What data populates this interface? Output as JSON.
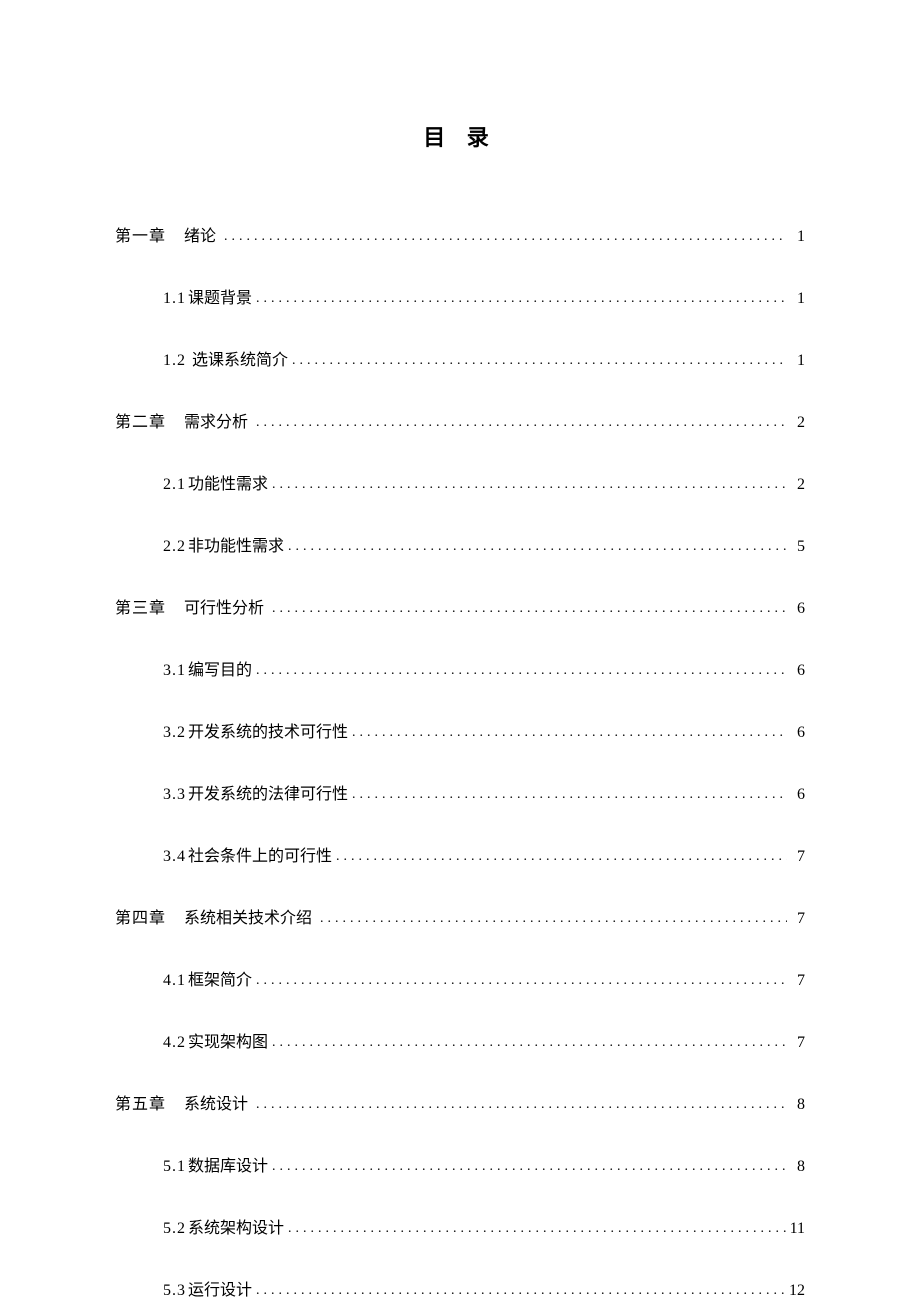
{
  "title": "目 录",
  "toc": [
    {
      "level": "chapter",
      "num": "第一章",
      "text": "绪论",
      "page": "1"
    },
    {
      "level": "section",
      "num": "1.1",
      "text": "课题背景",
      "page": "1"
    },
    {
      "level": "section",
      "num": "1.2",
      "text": "选课系统简介",
      "page": "1",
      "numSpaced": true
    },
    {
      "level": "chapter",
      "num": "第二章",
      "text": "需求分析",
      "page": "2"
    },
    {
      "level": "section",
      "num": "2.1",
      "text": "功能性需求",
      "page": "2"
    },
    {
      "level": "section",
      "num": "2.2",
      "text": "非功能性需求",
      "page": "5"
    },
    {
      "level": "chapter",
      "num": "第三章",
      "text": "可行性分析",
      "page": "6"
    },
    {
      "level": "section",
      "num": "3.1",
      "text": "编写目的",
      "page": "6"
    },
    {
      "level": "section",
      "num": "3.2",
      "text": "开发系统的技术可行性",
      "page": "6"
    },
    {
      "level": "section",
      "num": "3.3",
      "text": "开发系统的法律可行性",
      "page": "6"
    },
    {
      "level": "section",
      "num": "3.4",
      "text": "社会条件上的可行性",
      "page": "7"
    },
    {
      "level": "chapter",
      "num": "第四章",
      "text": "系统相关技术介绍",
      "page": "7"
    },
    {
      "level": "section",
      "num": "4.1",
      "text": "框架简介",
      "page": "7"
    },
    {
      "level": "section",
      "num": "4.2",
      "text": "实现架构图",
      "page": "7"
    },
    {
      "level": "chapter",
      "num": "第五章",
      "text": "系统设计",
      "page": "8"
    },
    {
      "level": "section",
      "num": "5.1",
      "text": "数据库设计",
      "page": "8"
    },
    {
      "level": "section",
      "num": "5.2",
      "text": "系统架构设计",
      "page": "11"
    },
    {
      "level": "section",
      "num": "5.3",
      "text": "运行设计",
      "page": "12"
    }
  ]
}
